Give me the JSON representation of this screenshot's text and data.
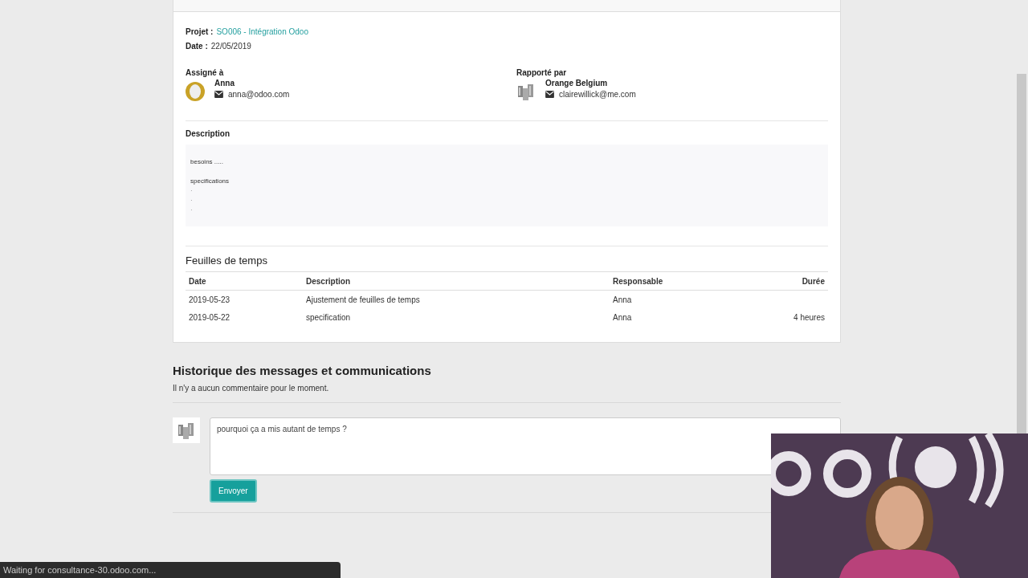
{
  "task": {
    "project_label": "Projet :",
    "project": "SO006 - Intégration Odoo",
    "date_label": "Date :",
    "date": "22/05/2019"
  },
  "assigned": {
    "label": "Assigné à",
    "name": "Anna",
    "email": "anna@odoo.com"
  },
  "reporter": {
    "label": "Rapporté par",
    "name": "Orange Belgium",
    "email": "clairewillick@me.com"
  },
  "description": {
    "title": "Description",
    "paragraphs": [
      [
        "besoins ....."
      ],
      [
        "specifications",
        "·",
        "·",
        "·"
      ]
    ]
  },
  "timesheets": {
    "title": "Feuilles de temps",
    "columns": [
      "Date",
      "Description",
      "Responsable",
      "Durée"
    ],
    "rows": [
      {
        "date": "2019-05-23",
        "description": "Ajustement de feuilles de temps",
        "responsible": "Anna"
      },
      {
        "date": "2019-05-22",
        "description": "specification",
        "responsible": "Anna",
        "duration": "4 heures"
      }
    ]
  },
  "history": {
    "title": "Historique des messages et communications",
    "empty": "Il n'y a aucun commentaire pour le moment.",
    "message": "pourquoi ça a mis autant de temps ?",
    "send": "Envoyer"
  },
  "status_bar": "Waiting for consultance-30.odoo.com..."
}
